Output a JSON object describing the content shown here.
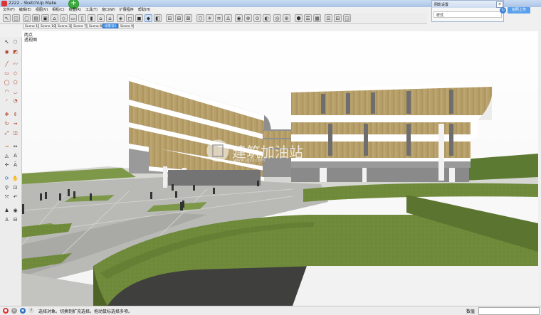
{
  "window": {
    "title": "2222 - SketchUp Make"
  },
  "menu": [
    "文件(F)",
    "编辑(E)",
    "视图(V)",
    "相机(C)",
    "绘图(R)",
    "工具(T)",
    "窗口(W)",
    "扩展程序",
    "帮助(H)"
  ],
  "toolbar": {
    "icons": [
      "new-icon",
      "open-icon",
      "save-icon",
      "house-icon",
      "iso-view-icon",
      "top-view-icon",
      "front-view-icon",
      "right-view-icon",
      "back-view-icon",
      "left-view-icon",
      "xray-icon",
      "wireframe-icon",
      "hidden-line-icon",
      "shaded-icon",
      "textured-icon",
      "monochrome-icon",
      "section-plane-icon",
      "section-display-icon",
      "section-cut-icon",
      "component-icon",
      "shadow-icon",
      "fog-icon",
      "walk-icon",
      "look-around-icon",
      "position-camera-icon",
      "zoom-extents-icon",
      "fill-icon",
      "3d-warehouse-icon",
      "geo-icon",
      "extension-icon",
      "layers-icon",
      "styles-icon",
      "outliner-icon",
      "scenes-icon",
      "sandbox-icon"
    ]
  },
  "scenes": {
    "tabs": [
      "Scene 1",
      "Scene 10",
      "Scene 3",
      "Scene 7",
      "Scene 8",
      "场景号1",
      "Scene 9"
    ],
    "selected": 5
  },
  "viewport": {
    "label1": "两点",
    "label2": "透视图"
  },
  "panel": {
    "title": "阴影设置",
    "close": "×",
    "field": "样式"
  },
  "upload": {
    "label": "拍照上传"
  },
  "watermark": {
    "text": "建筑加油站",
    "sub": "www.jzjyz.com"
  },
  "status": {
    "message": "选择对象。切换到扩充选择。拖动鼠标选择多项。",
    "measure_label": "数值"
  },
  "colors": {
    "grass": "#6f8a3a",
    "pavement": "#b9b9b6",
    "facade_wood": "#b79f6a",
    "selected_tab": "#3b8ee8"
  }
}
